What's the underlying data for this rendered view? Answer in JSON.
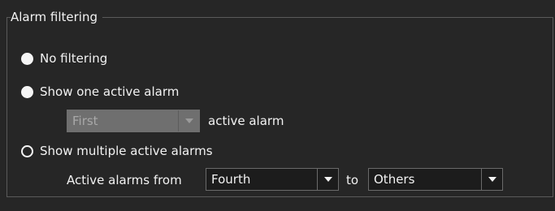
{
  "group": {
    "title": "Alarm filtering"
  },
  "options": {
    "no_filtering": {
      "label": "No filtering",
      "selected": false
    },
    "show_one": {
      "label": "Show one active alarm",
      "selected": false
    },
    "show_multiple": {
      "label": "Show multiple active alarms",
      "selected": true
    }
  },
  "one_alarm": {
    "select_value": "First",
    "suffix": "active alarm",
    "enabled": false
  },
  "multiple_alarms": {
    "prefix": "Active alarms from",
    "from_value": "Fourth",
    "to_label": "to",
    "to_value": "Others"
  },
  "icons": {
    "dropdown": "chevron-down-icon",
    "radio_unchecked": "radio-unchecked-icon",
    "radio_checked": "radio-checked-icon"
  },
  "colors": {
    "background": "#262626",
    "text": "#f2f2f2",
    "border": "#5a5a5a",
    "disabled_fill": "#6f6f6f"
  }
}
